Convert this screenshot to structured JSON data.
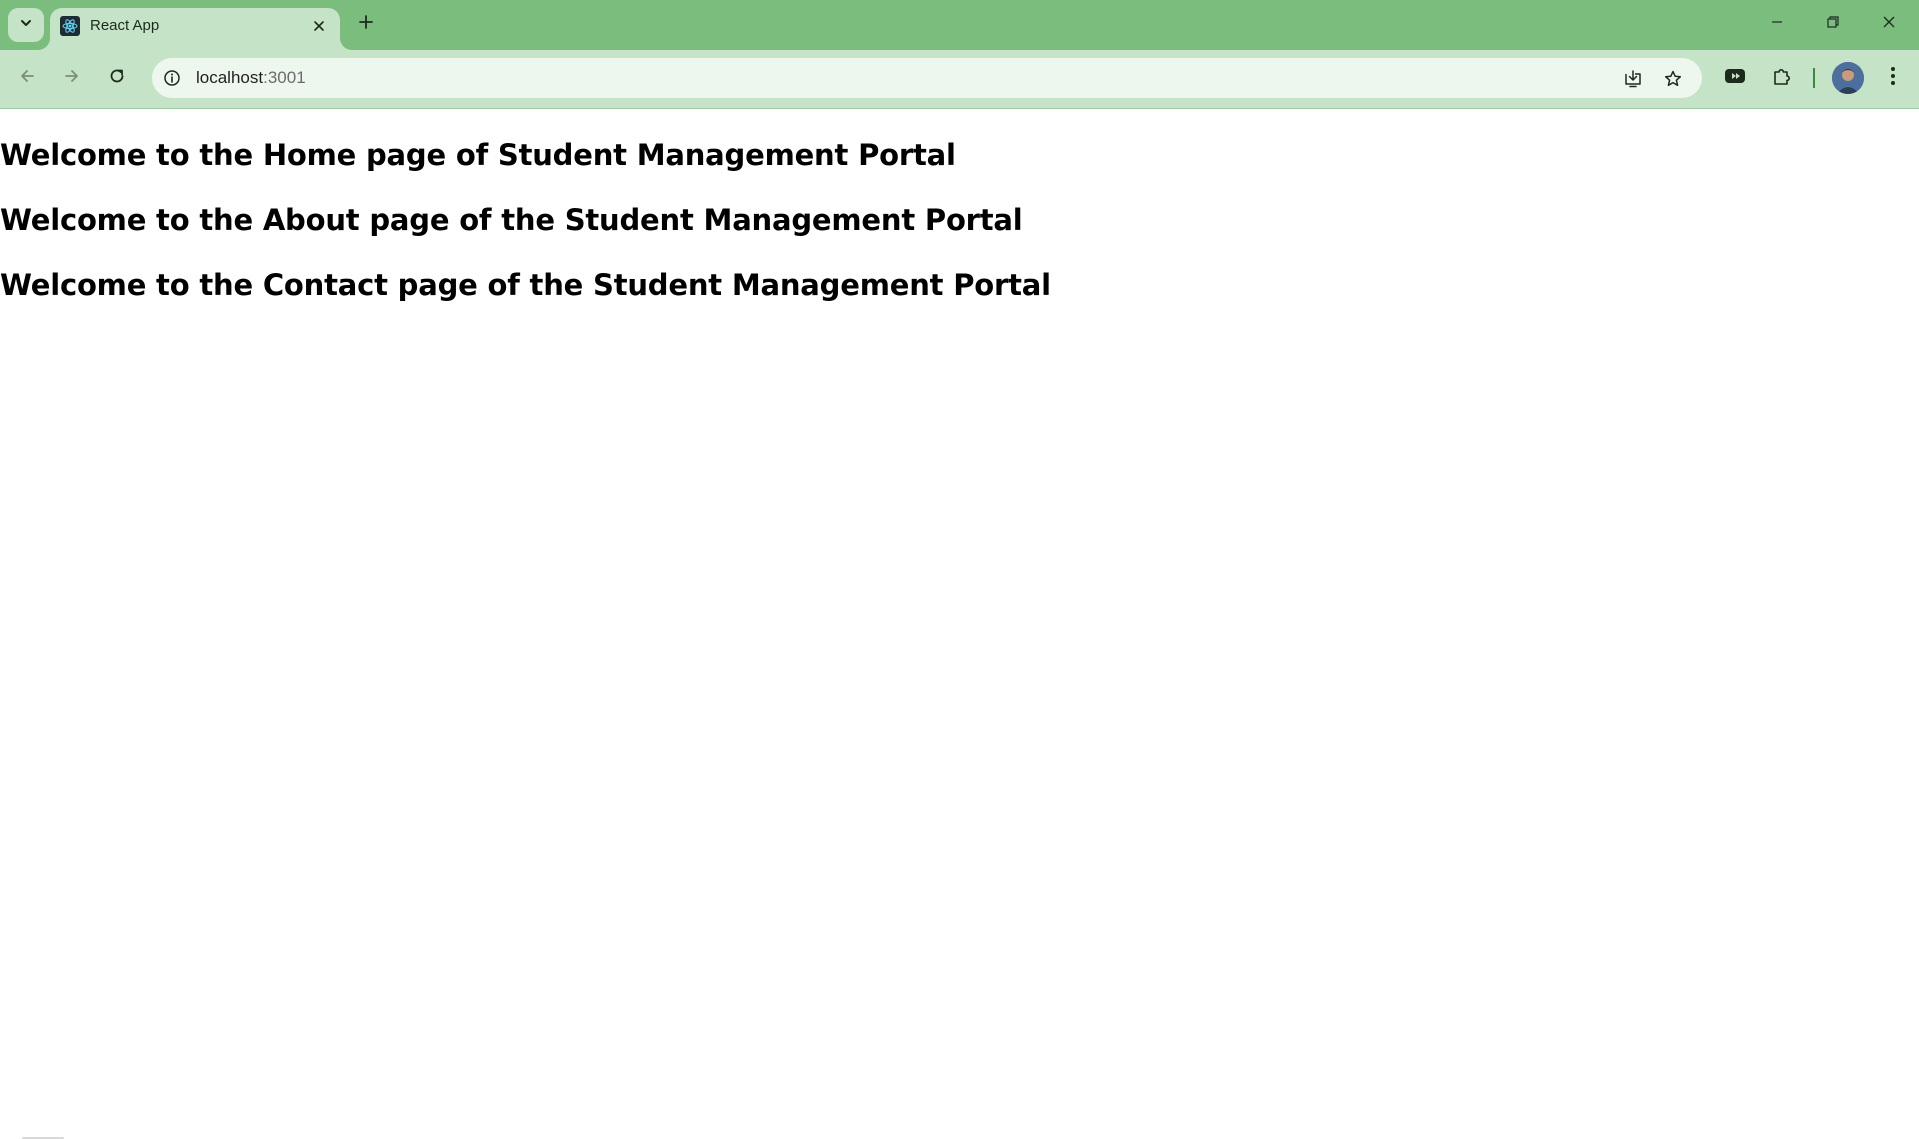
{
  "browser": {
    "tab": {
      "title": "React App",
      "favicon": "react-icon"
    },
    "address": {
      "host": "localhost",
      "port": ":3001"
    },
    "colors": {
      "tabstrip": "#7bbd7d",
      "toolbar": "#c5e3c6",
      "omnibox": "#eef7ee"
    }
  },
  "page": {
    "headings": {
      "home": "Welcome to the Home page of Student Management Portal",
      "about": "Welcome to the About page of the Student Management Portal",
      "contact": "Welcome to the Contact page of the Student Management Portal"
    }
  }
}
